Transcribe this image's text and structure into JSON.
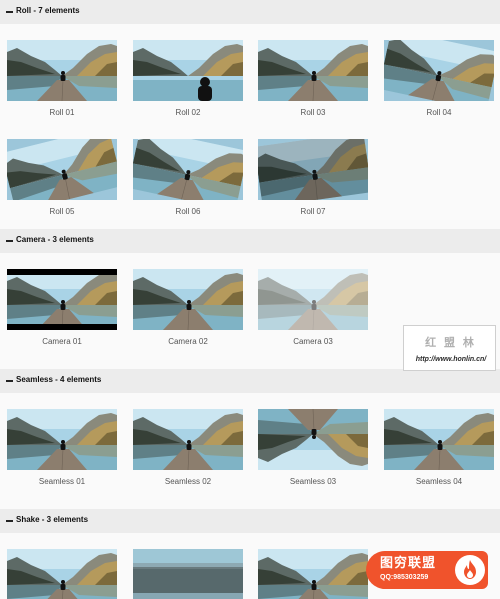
{
  "sections": [
    {
      "title": "Roll - 7 elements",
      "items": [
        {
          "label": "Roll 01",
          "variant": "normal"
        },
        {
          "label": "Roll 02",
          "variant": "person-close"
        },
        {
          "label": "Roll 03",
          "variant": "normal"
        },
        {
          "label": "Roll 04",
          "variant": "tilt-right"
        },
        {
          "label": "Roll 05",
          "variant": "tilt-left"
        },
        {
          "label": "Roll 06",
          "variant": "tilt-right"
        },
        {
          "label": "Roll 07",
          "variant": "tilt-dark"
        }
      ]
    },
    {
      "title": "Camera - 3 elements",
      "items": [
        {
          "label": "Camera 01",
          "variant": "letterbox"
        },
        {
          "label": "Camera 02",
          "variant": "normal"
        },
        {
          "label": "Camera 03",
          "variant": "faded"
        }
      ]
    },
    {
      "title": "Seamless - 4 elements",
      "items": [
        {
          "label": "Seamless 01",
          "variant": "normal"
        },
        {
          "label": "Seamless 02",
          "variant": "normal"
        },
        {
          "label": "Seamless 03",
          "variant": "mirrored"
        },
        {
          "label": "Seamless 04",
          "variant": "normal"
        }
      ]
    },
    {
      "title": "Shake - 3 elements",
      "items": [
        {
          "label": "",
          "variant": "normal"
        },
        {
          "label": "",
          "variant": "blurred"
        },
        {
          "label": "",
          "variant": "normal"
        }
      ]
    }
  ],
  "watermark": {
    "title": "红 盟 林",
    "url": "http://www.honlin.cn/"
  },
  "badge": {
    "title": "图穷联盟",
    "qq": "QQ:985303259",
    "icon": "flame-icon",
    "color": "#f0532c"
  }
}
